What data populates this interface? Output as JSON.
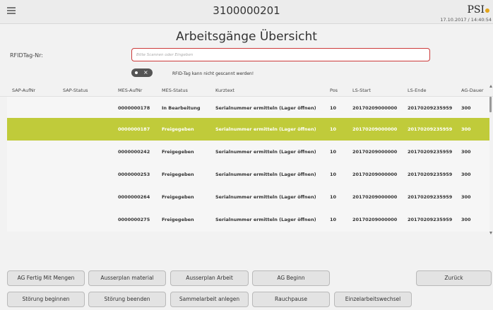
{
  "header": {
    "title": "3100000201",
    "logo_text": "PSI",
    "timestamp": "17.10.2017 / 14:40:54"
  },
  "page": {
    "heading": "Arbeitsgänge Übersicht"
  },
  "rfid": {
    "label": "RFIDTag-Nr:",
    "placeholder": "Bitte Scannen oder Eingeben",
    "toggle_symbol": "×",
    "hint": "RFID-Tag kann nicht gescannt werden!"
  },
  "table": {
    "columns": [
      "SAP-AufNr",
      "SAP-Status",
      "MES-AufNr",
      "MES-Status",
      "Kurztext",
      "Pos",
      "LS-Start",
      "LS-Ende",
      "AG-Dauer"
    ],
    "rows": [
      {
        "sap_aufnr": "",
        "sap_status": "",
        "mes_aufnr": "0000000178",
        "mes_status": "In Bearbeitung",
        "kurztext": "Serialnummer ermitteln (Lager öffnen)",
        "pos": "10",
        "ls_start": "20170209000000",
        "ls_ende": "20170209235959",
        "ag_dauer": "300",
        "selected": false
      },
      {
        "sap_aufnr": "",
        "sap_status": "",
        "mes_aufnr": "0000000187",
        "mes_status": "Freigegeben",
        "kurztext": "Serialnummer ermitteln (Lager öffnen)",
        "pos": "10",
        "ls_start": "20170209000000",
        "ls_ende": "20170209235959",
        "ag_dauer": "300",
        "selected": true
      },
      {
        "sap_aufnr": "",
        "sap_status": "",
        "mes_aufnr": "0000000242",
        "mes_status": "Freigegeben",
        "kurztext": "Serialnummer ermitteln (Lager öffnen)",
        "pos": "10",
        "ls_start": "20170209000000",
        "ls_ende": "20170209235959",
        "ag_dauer": "300",
        "selected": false
      },
      {
        "sap_aufnr": "",
        "sap_status": "",
        "mes_aufnr": "0000000253",
        "mes_status": "Freigegeben",
        "kurztext": "Serialnummer ermitteln (Lager öffnen)",
        "pos": "10",
        "ls_start": "20170209000000",
        "ls_ende": "20170209235959",
        "ag_dauer": "300",
        "selected": false
      },
      {
        "sap_aufnr": "",
        "sap_status": "",
        "mes_aufnr": "0000000264",
        "mes_status": "Freigegeben",
        "kurztext": "Serialnummer ermitteln (Lager öffnen)",
        "pos": "10",
        "ls_start": "20170209000000",
        "ls_ende": "20170209235959",
        "ag_dauer": "300",
        "selected": false
      },
      {
        "sap_aufnr": "",
        "sap_status": "",
        "mes_aufnr": "0000000275",
        "mes_status": "Freigegeben",
        "kurztext": "Serialnummer ermitteln (Lager öffnen)",
        "pos": "10",
        "ls_start": "20170209000000",
        "ls_ende": "20170209235959",
        "ag_dauer": "300",
        "selected": false
      }
    ]
  },
  "buttons": {
    "ag_fertig_mit_mengen": "AG Fertig Mit Mengen",
    "ausserplan_material": "Ausserplan material",
    "ausserplan_arbeit": "Ausserplan Arbeit",
    "ag_beginn": "AG Beginn",
    "zurueck": "Zurück",
    "stoerung_beginnen": "Störung beginnen",
    "stoerung_beenden": "Störung beenden",
    "sammelarbeit_anlegen": "Sammelarbeit anlegen",
    "rauchpause": "Rauchpause",
    "einzelarbeitswechsel": "Einzelarbeitswechsel"
  },
  "colors": {
    "selected_row": "#c0cb3a",
    "input_border": "#cc3a3a",
    "logo_accent": "#e4a51a"
  }
}
